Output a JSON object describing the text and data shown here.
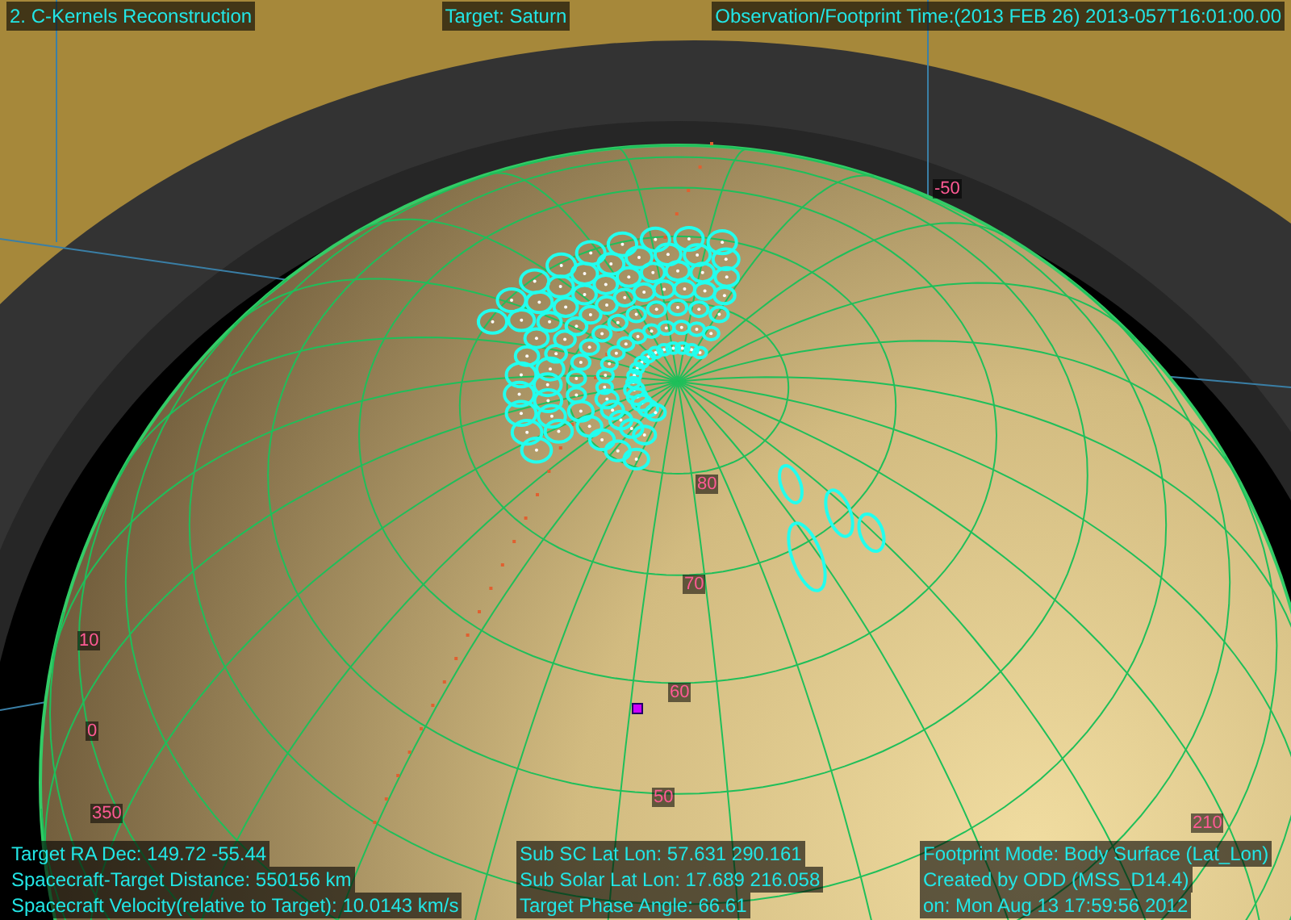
{
  "header": {
    "title": "2. C-Kernels Reconstruction",
    "target": "Target: Saturn",
    "time": "Observation/Footprint Time:(2013 FEB 26) 2013-057T16:01:00.00"
  },
  "grid_labels": [
    {
      "text": "80"
    },
    {
      "text": "70"
    },
    {
      "text": "60"
    },
    {
      "text": "50"
    },
    {
      "text": "10"
    },
    {
      "text": "0"
    },
    {
      "text": "350"
    },
    {
      "text": "-50"
    },
    {
      "text": "210"
    }
  ],
  "info_left": [
    "Target RA Dec: 149.72  -55.44",
    "Spacecraft-Target Distance:  550156 km",
    "Spacecraft Velocity(relative to Target): 10.0143 km/s"
  ],
  "info_middle": [
    "Sub SC Lat Lon: 57.631  290.161",
    "Sub Solar Lat Lon: 17.689  216.058",
    "Target Phase Angle: 66.61"
  ],
  "info_right": [
    "Footprint Mode: Body Surface (Lat_Lon)",
    "Created by ODD (MSS_D14.4)",
    "on: Mon Aug 13 17:59:56 2012"
  ]
}
